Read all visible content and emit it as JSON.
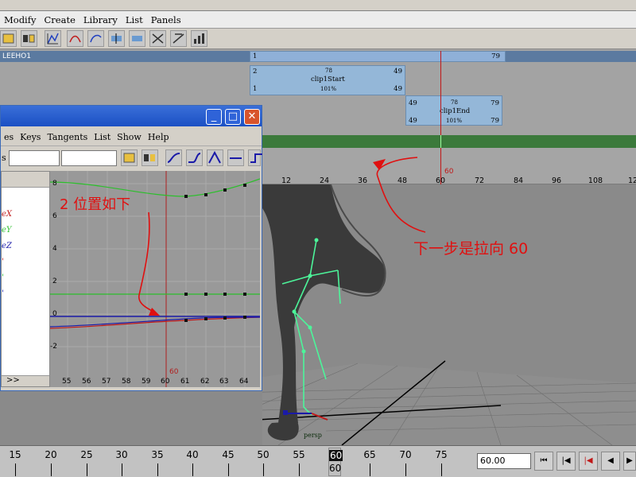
{
  "menubar": {
    "items": [
      "Modify",
      "Create",
      "Library",
      "List",
      "Panels"
    ]
  },
  "trax": {
    "track_name": "LEEHO1",
    "track_start": "1",
    "track_end": "79",
    "clip_start": {
      "src_start": "2",
      "clip_len": "78",
      "name": "clip1Start",
      "src_end": "49",
      "start": "1",
      "scale": "101%",
      "end": "49"
    },
    "clip_end": {
      "src_start": "49",
      "clip_len": "78",
      "name": "clip1End",
      "src_end": "79",
      "start": "49",
      "scale": "101%",
      "end": "79"
    }
  },
  "ruler": {
    "labels": [
      "12",
      "24",
      "36",
      "48",
      "60",
      "72",
      "84",
      "96",
      "108",
      "12"
    ],
    "current": "60"
  },
  "graph_editor": {
    "menu": [
      "es",
      "Keys",
      "Tangents",
      "List",
      "Show",
      "Help"
    ],
    "field_label": "s",
    "outline_items": [
      "eX",
      "eY",
      "eZ",
      "'",
      "'",
      "'"
    ],
    "expand_button": ">>",
    "y_labels": [
      "8",
      "6",
      "4",
      "2",
      "0",
      "-2"
    ],
    "x_labels": [
      "55",
      "56",
      "57",
      "58",
      "59",
      "60",
      "61",
      "62",
      "63",
      "64"
    ],
    "current_frame": "60"
  },
  "viewport": {
    "camera": "persp"
  },
  "annotations": {
    "note1": "2 位置如下",
    "note2": "下一步是拉向 60"
  },
  "timeslider": {
    "labels": [
      "15",
      "20",
      "25",
      "30",
      "35",
      "40",
      "45",
      "50",
      "55",
      "60",
      "65",
      "70",
      "75"
    ],
    "current": "60",
    "current_sub": "60",
    "frame_value": "60.00"
  },
  "colors": {
    "accent": "#1b50c4",
    "curve_green": "#2cbf2c",
    "curve_blue": "#1a1aa8",
    "curve_red": "#c01818",
    "annotation": "#e01010",
    "skeleton": "#4cf59a"
  }
}
